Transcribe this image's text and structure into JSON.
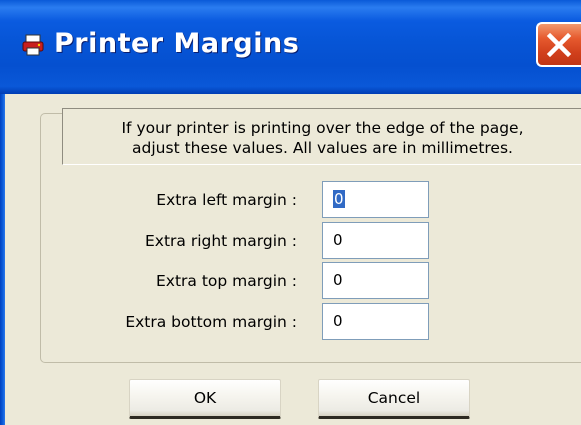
{
  "window": {
    "title": "Printer Margins",
    "icon": "printer-icon",
    "close_icon": "close-icon"
  },
  "info": {
    "line1": "If your printer is printing over the edge of the page,",
    "line2": "adjust these values. All values are in millimetres."
  },
  "fields": [
    {
      "label": "Extra left margin :",
      "value": "0",
      "selected": true
    },
    {
      "label": "Extra right margin :",
      "value": "0"
    },
    {
      "label": "Extra top margin :",
      "value": "0"
    },
    {
      "label": "Extra bottom margin :",
      "value": "0"
    }
  ],
  "buttons": {
    "ok": "OK",
    "cancel": "Cancel"
  },
  "colors": {
    "titlebar": "#0550d0",
    "close": "#d1401c",
    "dialog_bg": "#ece9d8",
    "selection": "#316ac5"
  }
}
